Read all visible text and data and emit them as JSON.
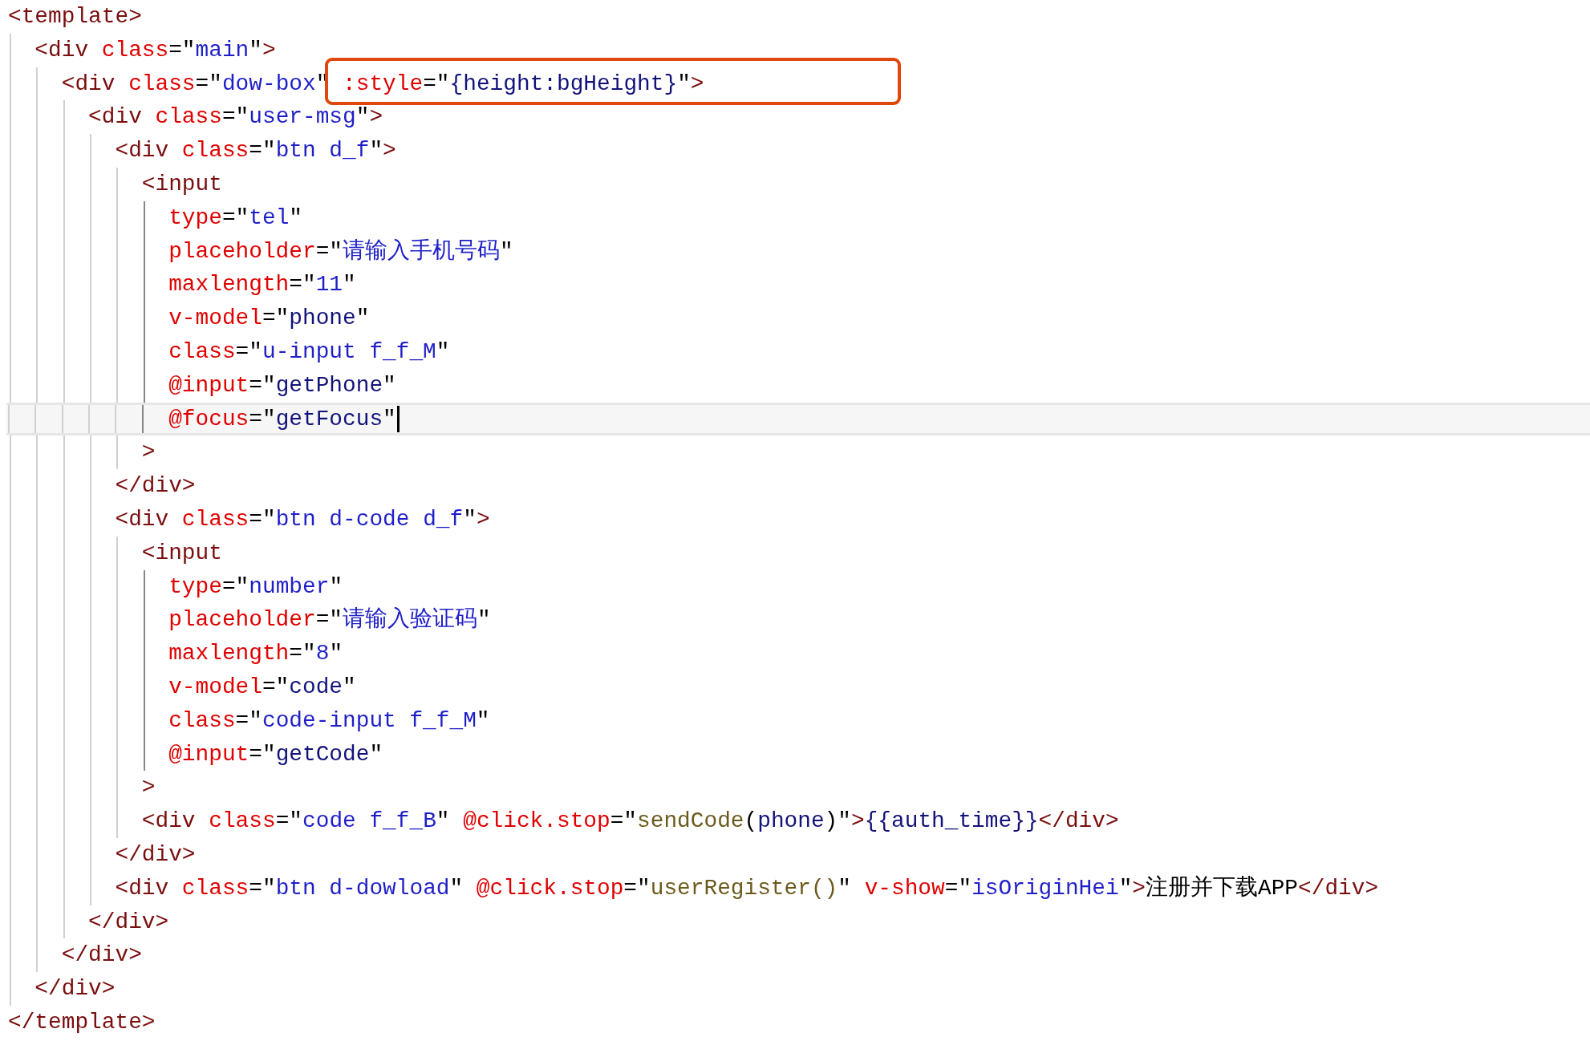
{
  "editor": {
    "lines": [
      {
        "current": false,
        "tokens": [
          {
            "kind": "tag",
            "text": "<template>"
          }
        ]
      },
      {
        "current": false,
        "tokens": [
          {
            "kind": "tag",
            "text": "  <div"
          },
          {
            "kind": "attr",
            "text": " class"
          },
          {
            "kind": "plain",
            "text": "=\""
          },
          {
            "kind": "string",
            "text": "main"
          },
          {
            "kind": "plain",
            "text": "\""
          },
          {
            "kind": "tag",
            "text": ">"
          }
        ]
      },
      {
        "current": false,
        "tokens": [
          {
            "kind": "tag",
            "text": "    <div"
          },
          {
            "kind": "attr",
            "text": " class"
          },
          {
            "kind": "plain",
            "text": "=\""
          },
          {
            "kind": "string",
            "text": "dow-box"
          },
          {
            "kind": "plain",
            "text": "\""
          }
        ],
        "boxed_tokens": [
          {
            "kind": "attr",
            "text": " :style"
          },
          {
            "kind": "plain",
            "text": "=\""
          },
          {
            "kind": "ident",
            "text": "{height:bgHeight}"
          },
          {
            "kind": "plain",
            "text": "\""
          },
          {
            "kind": "tag",
            "text": ">"
          }
        ]
      },
      {
        "current": false,
        "tokens": [
          {
            "kind": "tag",
            "text": "      <div"
          },
          {
            "kind": "attr",
            "text": " class"
          },
          {
            "kind": "plain",
            "text": "=\""
          },
          {
            "kind": "string",
            "text": "user-msg"
          },
          {
            "kind": "plain",
            "text": "\""
          },
          {
            "kind": "tag",
            "text": ">"
          }
        ]
      },
      {
        "current": false,
        "tokens": [
          {
            "kind": "tag",
            "text": "        <div"
          },
          {
            "kind": "attr",
            "text": " class"
          },
          {
            "kind": "plain",
            "text": "=\""
          },
          {
            "kind": "string",
            "text": "btn d_f"
          },
          {
            "kind": "plain",
            "text": "\""
          },
          {
            "kind": "tag",
            "text": ">"
          }
        ]
      },
      {
        "current": false,
        "tokens": [
          {
            "kind": "tag",
            "text": "          <input"
          }
        ]
      },
      {
        "current": false,
        "tokens": [
          {
            "kind": "attr",
            "text": "            type"
          },
          {
            "kind": "plain",
            "text": "=\""
          },
          {
            "kind": "string",
            "text": "tel"
          },
          {
            "kind": "plain",
            "text": "\""
          }
        ]
      },
      {
        "current": false,
        "tokens": [
          {
            "kind": "attr",
            "text": "            placeholder"
          },
          {
            "kind": "plain",
            "text": "=\""
          },
          {
            "kind": "string",
            "text": "请输入手机号码"
          },
          {
            "kind": "plain",
            "text": "\""
          }
        ]
      },
      {
        "current": false,
        "tokens": [
          {
            "kind": "attr",
            "text": "            maxlength"
          },
          {
            "kind": "plain",
            "text": "=\""
          },
          {
            "kind": "string",
            "text": "11"
          },
          {
            "kind": "plain",
            "text": "\""
          }
        ]
      },
      {
        "current": false,
        "tokens": [
          {
            "kind": "attr",
            "text": "            v-model"
          },
          {
            "kind": "plain",
            "text": "=\""
          },
          {
            "kind": "ident",
            "text": "phone"
          },
          {
            "kind": "plain",
            "text": "\""
          }
        ]
      },
      {
        "current": false,
        "tokens": [
          {
            "kind": "attr",
            "text": "            class"
          },
          {
            "kind": "plain",
            "text": "=\""
          },
          {
            "kind": "string",
            "text": "u-input f_f_M"
          },
          {
            "kind": "plain",
            "text": "\""
          }
        ]
      },
      {
        "current": false,
        "tokens": [
          {
            "kind": "attr",
            "text": "            @input"
          },
          {
            "kind": "plain",
            "text": "=\""
          },
          {
            "kind": "ident",
            "text": "getPhone"
          },
          {
            "kind": "plain",
            "text": "\""
          }
        ]
      },
      {
        "current": true,
        "tokens": [
          {
            "kind": "attr",
            "text": "            @focus"
          },
          {
            "kind": "plain",
            "text": "=\""
          },
          {
            "kind": "ident",
            "text": "getFocus"
          },
          {
            "kind": "plain",
            "text": "\""
          }
        ]
      },
      {
        "current": false,
        "tokens": [
          {
            "kind": "tag",
            "text": "          >"
          }
        ]
      },
      {
        "current": false,
        "tokens": [
          {
            "kind": "tag",
            "text": "        </div>"
          }
        ]
      },
      {
        "current": false,
        "tokens": [
          {
            "kind": "tag",
            "text": "        <div"
          },
          {
            "kind": "attr",
            "text": " class"
          },
          {
            "kind": "plain",
            "text": "=\""
          },
          {
            "kind": "string",
            "text": "btn d-code d_f"
          },
          {
            "kind": "plain",
            "text": "\""
          },
          {
            "kind": "tag",
            "text": ">"
          }
        ]
      },
      {
        "current": false,
        "tokens": [
          {
            "kind": "tag",
            "text": "          <input"
          }
        ]
      },
      {
        "current": false,
        "tokens": [
          {
            "kind": "attr",
            "text": "            type"
          },
          {
            "kind": "plain",
            "text": "=\""
          },
          {
            "kind": "string",
            "text": "number"
          },
          {
            "kind": "plain",
            "text": "\""
          }
        ]
      },
      {
        "current": false,
        "tokens": [
          {
            "kind": "attr",
            "text": "            placeholder"
          },
          {
            "kind": "plain",
            "text": "=\""
          },
          {
            "kind": "string",
            "text": "请输入验证码"
          },
          {
            "kind": "plain",
            "text": "\""
          }
        ]
      },
      {
        "current": false,
        "tokens": [
          {
            "kind": "attr",
            "text": "            maxlength"
          },
          {
            "kind": "plain",
            "text": "=\""
          },
          {
            "kind": "string",
            "text": "8"
          },
          {
            "kind": "plain",
            "text": "\""
          }
        ]
      },
      {
        "current": false,
        "tokens": [
          {
            "kind": "attr",
            "text": "            v-model"
          },
          {
            "kind": "plain",
            "text": "=\""
          },
          {
            "kind": "ident",
            "text": "code"
          },
          {
            "kind": "plain",
            "text": "\""
          }
        ]
      },
      {
        "current": false,
        "tokens": [
          {
            "kind": "attr",
            "text": "            class"
          },
          {
            "kind": "plain",
            "text": "=\""
          },
          {
            "kind": "string",
            "text": "code-input f_f_M"
          },
          {
            "kind": "plain",
            "text": "\""
          }
        ]
      },
      {
        "current": false,
        "tokens": [
          {
            "kind": "attr",
            "text": "            @input"
          },
          {
            "kind": "plain",
            "text": "=\""
          },
          {
            "kind": "ident",
            "text": "getCode"
          },
          {
            "kind": "plain",
            "text": "\""
          }
        ]
      },
      {
        "current": false,
        "tokens": [
          {
            "kind": "tag",
            "text": "          >"
          }
        ]
      },
      {
        "current": false,
        "tokens": [
          {
            "kind": "tag",
            "text": "          <div"
          },
          {
            "kind": "attr",
            "text": " class"
          },
          {
            "kind": "plain",
            "text": "=\""
          },
          {
            "kind": "string",
            "text": "code f_f_B"
          },
          {
            "kind": "plain",
            "text": "\""
          },
          {
            "kind": "attr",
            "text": " @click.stop"
          },
          {
            "kind": "plain",
            "text": "=\""
          },
          {
            "kind": "method",
            "text": "sendCode"
          },
          {
            "kind": "plain",
            "text": "("
          },
          {
            "kind": "ident",
            "text": "phone"
          },
          {
            "kind": "plain",
            "text": ")\""
          },
          {
            "kind": "tag",
            "text": ">"
          },
          {
            "kind": "ident",
            "text": "{{auth_time}}"
          },
          {
            "kind": "tag",
            "text": "</div>"
          }
        ]
      },
      {
        "current": false,
        "tokens": [
          {
            "kind": "tag",
            "text": "        </div>"
          }
        ]
      },
      {
        "current": false,
        "tokens": [
          {
            "kind": "tag",
            "text": "        <div"
          },
          {
            "kind": "attr",
            "text": " class"
          },
          {
            "kind": "plain",
            "text": "=\""
          },
          {
            "kind": "string",
            "text": "btn d-dowload"
          },
          {
            "kind": "plain",
            "text": "\""
          },
          {
            "kind": "attr",
            "text": " @click.stop"
          },
          {
            "kind": "plain",
            "text": "=\""
          },
          {
            "kind": "method",
            "text": "userRegister()"
          },
          {
            "kind": "plain",
            "text": "\""
          },
          {
            "kind": "attr",
            "text": " v-show"
          },
          {
            "kind": "plain",
            "text": "=\""
          },
          {
            "kind": "string",
            "text": "isOriginHei"
          },
          {
            "kind": "plain",
            "text": "\""
          },
          {
            "kind": "tag",
            "text": ">"
          },
          {
            "kind": "plain",
            "text": "注册并下载APP"
          },
          {
            "kind": "tag",
            "text": "</div>"
          }
        ]
      },
      {
        "current": false,
        "tokens": [
          {
            "kind": "tag",
            "text": "      </div>"
          }
        ]
      },
      {
        "current": false,
        "tokens": [
          {
            "kind": "tag",
            "text": "    </div>"
          }
        ]
      },
      {
        "current": false,
        "tokens": [
          {
            "kind": "tag",
            "text": "  </div>"
          }
        ]
      },
      {
        "current": false,
        "tokens": [
          {
            "kind": "tag",
            "text": "</template>"
          }
        ]
      }
    ]
  }
}
